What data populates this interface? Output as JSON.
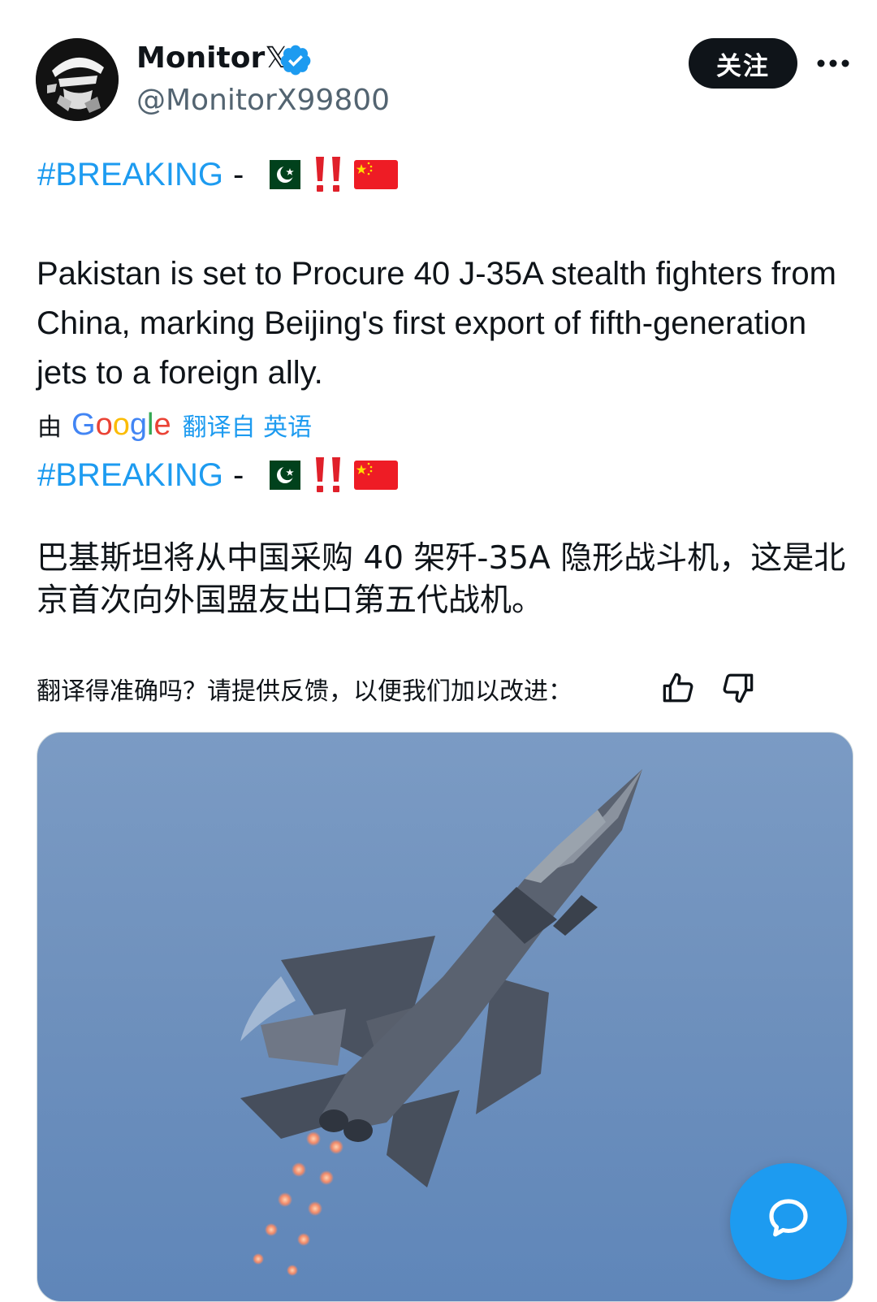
{
  "post": {
    "author": {
      "display_name": "Monitor",
      "display_name_suffix": "𝕏",
      "handle": "@MonitorX99800",
      "verified": true
    },
    "follow_label": "关注",
    "more_icon": "more-horizontal-icon",
    "original": {
      "hashtag": "#BREAKING",
      "dash": "-",
      "emojis": [
        "flag-pakistan",
        "double-exclamation",
        "flag-china"
      ],
      "body": "Pakistan is set to Procure 40 J-35A stealth fighters from China, marking Beijing's first export of fifth-generation jets to a foreign ally."
    },
    "translation_note": {
      "by": "由",
      "provider": "Google",
      "link": "翻译自 英语"
    },
    "translated": {
      "hashtag": "#BREAKING",
      "dash": "-",
      "body": "巴基斯坦将从中国采购 40 架歼-35A 隐形战斗机，这是北京首次向外国盟友出口第五代战机。"
    },
    "feedback": {
      "prompt": "翻译得准确吗？请提供反馈，以便我们加以改进：",
      "up_icon": "thumbs-up-icon",
      "down_icon": "thumbs-down-icon"
    },
    "media": {
      "subject": "fighter-jet-photo"
    }
  },
  "fab": {
    "icon": "chat-bubble-icon"
  },
  "colors": {
    "link": "#1d9bf0",
    "text": "#0f1419",
    "muted": "#536471",
    "sky": "#6f91bd"
  }
}
